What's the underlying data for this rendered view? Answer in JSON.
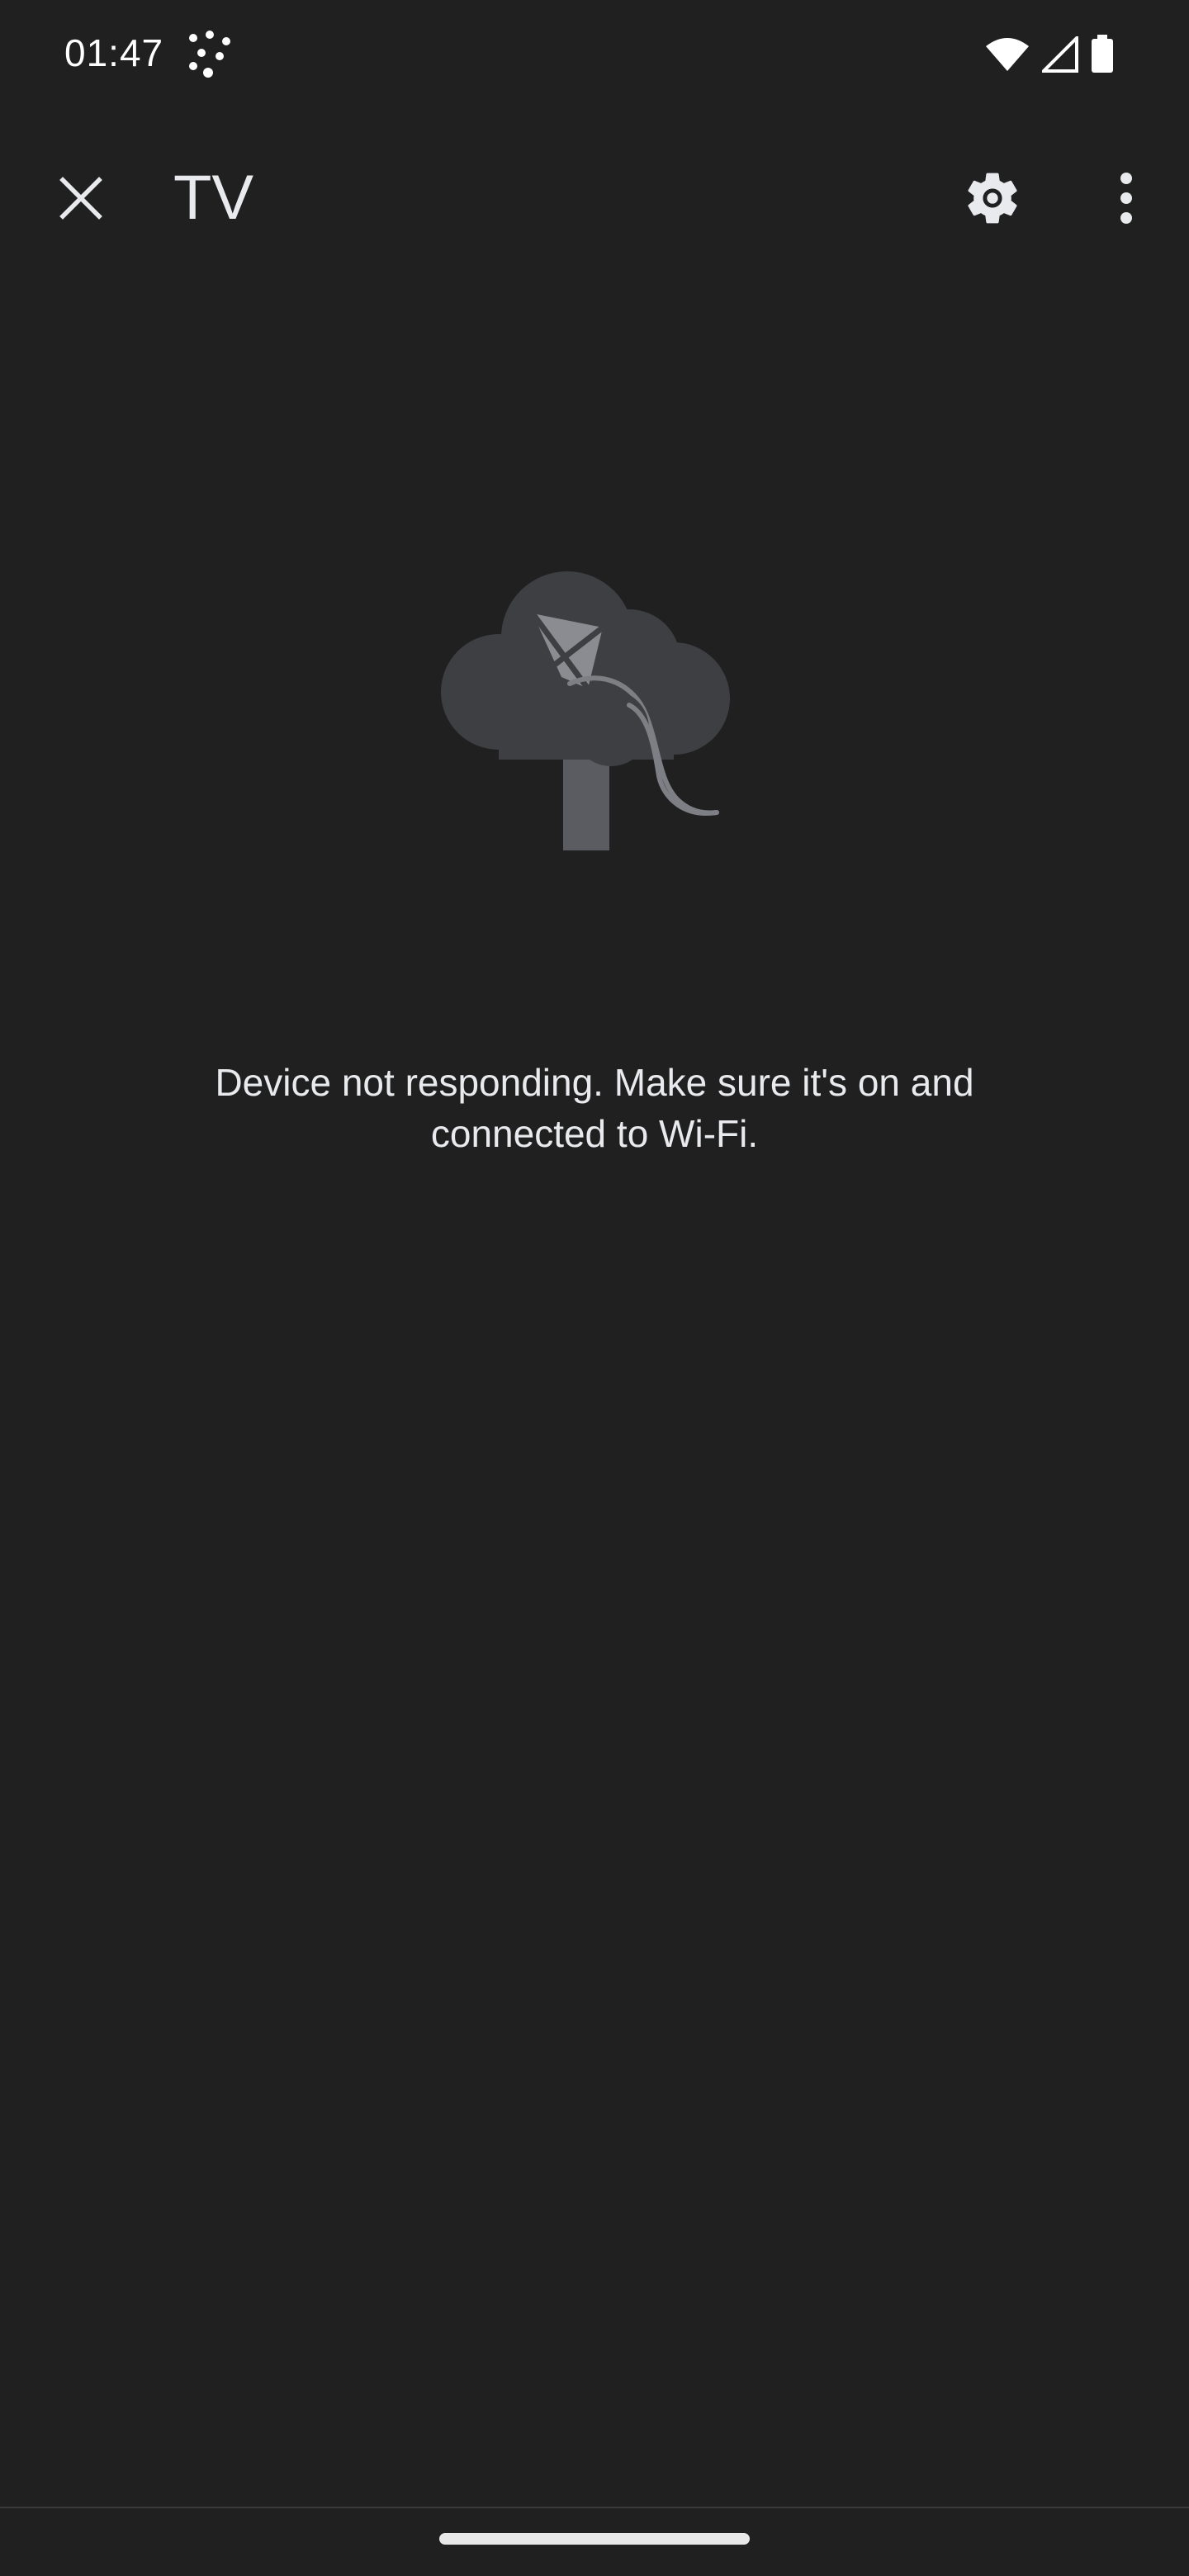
{
  "status_bar": {
    "time": "01:47"
  },
  "app_bar": {
    "title": "TV",
    "close_icon": "close-icon",
    "settings_icon": "gear-icon",
    "more_icon": "more-vert-icon"
  },
  "empty_state": {
    "illustration": "cloud-tree-kite-illustration",
    "message": "Device not responding. Make sure it's on and connected to Wi-Fi."
  },
  "colors": {
    "background": "#202020",
    "text": "#e8eaed",
    "illustration_dark": "#3c3d40",
    "illustration_light": "#7d7f84"
  }
}
